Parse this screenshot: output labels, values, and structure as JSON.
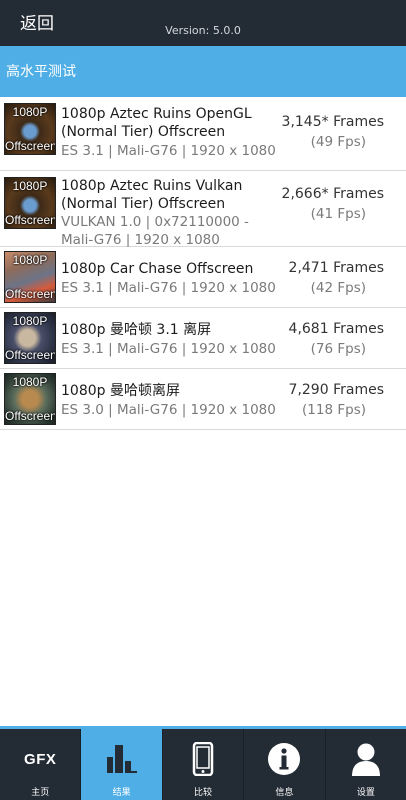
{
  "header": {
    "back_label": "返回",
    "version": "Version: 5.0.0"
  },
  "section": {
    "title": "高水平测试"
  },
  "results": [
    {
      "thumb_top": "1080P",
      "thumb_bottom": "Offscreen",
      "title_line1": "1080p Aztec Ruins OpenGL",
      "title_line2": "(Normal Tier) Offscreen",
      "meta_line1": "ES 3.1 | Mali-G76 | 1920 x 1080",
      "meta_line2": "",
      "score": "3,145* Frames",
      "fps": "(49 Fps)"
    },
    {
      "thumb_top": "1080P",
      "thumb_bottom": "Offscreen",
      "title_line1": "1080p Aztec Ruins Vulkan",
      "title_line2": "(Normal Tier) Offscreen",
      "meta_line1": "VULKAN 1.0 | 0x72110000 -",
      "meta_line2": "Mali-G76 | 1920 x 1080",
      "score": "2,666* Frames",
      "fps": "(41 Fps)"
    },
    {
      "thumb_top": "1080P",
      "thumb_bottom": "Offscreen",
      "title_line1": "1080p Car Chase Offscreen",
      "title_line2": "",
      "meta_line1": "ES 3.1 | Mali-G76 | 1920 x 1080",
      "meta_line2": "",
      "score": "2,471 Frames",
      "fps": "(42 Fps)"
    },
    {
      "thumb_top": "1080P",
      "thumb_bottom": "Offscreen",
      "title_line1": "1080p 曼哈顿 3.1 离屏",
      "title_line2": "",
      "meta_line1": "ES 3.1 | Mali-G76 | 1920 x 1080",
      "meta_line2": "",
      "score": "4,681 Frames",
      "fps": "(76 Fps)"
    },
    {
      "thumb_top": "1080P",
      "thumb_bottom": "Offscreen",
      "title_line1": "1080p 曼哈顿离屏",
      "title_line2": "",
      "meta_line1": "ES 3.0 | Mali-G76 | 1920 x 1080",
      "meta_line2": "",
      "score": "7,290 Frames",
      "fps": "(118 Fps)"
    }
  ],
  "tabs": [
    {
      "label": "主页",
      "icon": "gfx-logo-icon",
      "icon_text": "GFX",
      "active": false
    },
    {
      "label": "结果",
      "icon": "bar-chart-icon",
      "active": true
    },
    {
      "label": "比较",
      "icon": "phone-icon",
      "active": false
    },
    {
      "label": "信息",
      "icon": "info-icon",
      "active": false
    },
    {
      "label": "设置",
      "icon": "user-icon",
      "active": false
    }
  ],
  "colors": {
    "topbar": "#232b35",
    "accent": "#4faee5"
  }
}
